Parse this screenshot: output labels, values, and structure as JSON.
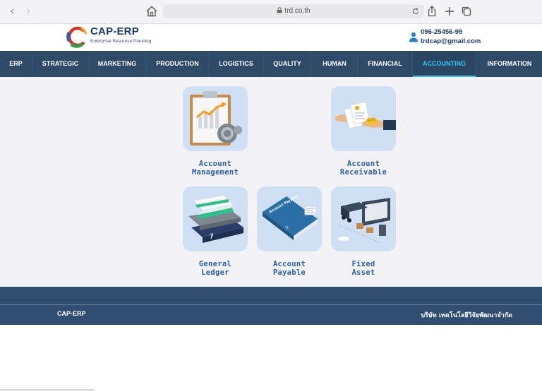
{
  "browser": {
    "back_glyph": "‹",
    "forward_glyph": "›",
    "url": "trd.co.th",
    "icons": [
      "home-icon",
      "lock-icon",
      "reload-icon",
      "share-icon",
      "new-tab-icon",
      "tabs-icon"
    ]
  },
  "header": {
    "logo_title": "CAP-ERP",
    "logo_subtitle": "Enterprise Resource Planning",
    "phone": "096-25456-99",
    "email": "trdcap@gmail.com"
  },
  "nav": {
    "items": [
      {
        "label": "ERP"
      },
      {
        "label": "STRATEGIC"
      },
      {
        "label": "MARKETING"
      },
      {
        "label": "PRODUCTION"
      },
      {
        "label": "LOGISTICS"
      },
      {
        "label": "QUALITY"
      },
      {
        "label": "HUMAN"
      },
      {
        "label": "FINANCIAL"
      },
      {
        "label": "ACCOUNTING"
      },
      {
        "label": "INFORMATION"
      }
    ],
    "active": "ACCOUNTING"
  },
  "modules": [
    {
      "line1": "Account",
      "line2": "Management",
      "icon": "chart-clipboard-icon"
    },
    {
      "line1": "Account",
      "line2": "Receivable",
      "icon": "payment-hand-icon"
    },
    {
      "line1": "General",
      "line2": "Ledger",
      "icon": "ledger-books-icon"
    },
    {
      "line1": "Account",
      "line2": "Payable",
      "icon": "account-payable-book-icon",
      "book_text": "Account Payable"
    },
    {
      "line1": "Fixed",
      "line2": "Asset",
      "icon": "warehouse-asset-icon"
    }
  ],
  "footer": {
    "brand": "CAP-ERP",
    "company": "บริษัท เทคโนโลยีวิจัยพัฒนาจำกัด"
  },
  "colors": {
    "nav_bg": "#2f4a69",
    "nav_active_text": "#35c2f5",
    "tile_bg": "#cfe0f5",
    "label_blue": "#2d5fa8",
    "footer_bg": "#2f4e6f"
  }
}
